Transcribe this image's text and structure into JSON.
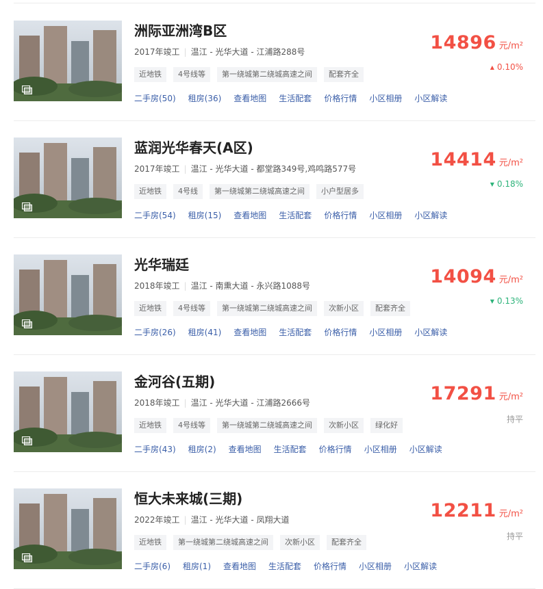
{
  "colors": {
    "price": "#f25044",
    "up": "#f25044",
    "down": "#2db37a",
    "link": "#3a5ea8"
  },
  "unit": "元/m²",
  "items": [
    {
      "name": "洲际亚洲湾B区",
      "year": "2017年竣工",
      "location": "温江 - 光华大道 - 江浦路288号",
      "tags": [
        "近地铁",
        "4号线等",
        "第一绕城第二绕城高速之间",
        "配套齐全"
      ],
      "links": [
        "二手房(50)",
        "租房(36)",
        "查看地图",
        "生活配套",
        "价格行情",
        "小区相册",
        "小区解读"
      ],
      "price": "14896",
      "change": "0.10%",
      "trend": "up",
      "trend_icon": "triangle-up-icon"
    },
    {
      "name": "蓝润光华春天(A区)",
      "year": "2017年竣工",
      "location": "温江 - 光华大道 - 都堂路349号,鸡鸣路577号",
      "tags": [
        "近地铁",
        "4号线",
        "第一绕城第二绕城高速之间",
        "小户型居多"
      ],
      "links": [
        "二手房(54)",
        "租房(15)",
        "查看地图",
        "生活配套",
        "价格行情",
        "小区相册",
        "小区解读"
      ],
      "price": "14414",
      "change": "0.18%",
      "trend": "down",
      "trend_icon": "triangle-down-icon"
    },
    {
      "name": "光华瑞廷",
      "year": "2018年竣工",
      "location": "温江 - 南熏大道 - 永兴路1088号",
      "tags": [
        "近地铁",
        "4号线等",
        "第一绕城第二绕城高速之间",
        "次新小区",
        "配套齐全"
      ],
      "links": [
        "二手房(26)",
        "租房(41)",
        "查看地图",
        "生活配套",
        "价格行情",
        "小区相册",
        "小区解读"
      ],
      "price": "14094",
      "change": "0.13%",
      "trend": "down",
      "trend_icon": "triangle-down-icon"
    },
    {
      "name": "金河谷(五期)",
      "year": "2018年竣工",
      "location": "温江 - 光华大道 - 江浦路2666号",
      "tags": [
        "近地铁",
        "4号线等",
        "第一绕城第二绕城高速之间",
        "次新小区",
        "绿化好"
      ],
      "links": [
        "二手房(43)",
        "租房(2)",
        "查看地图",
        "生活配套",
        "价格行情",
        "小区相册",
        "小区解读"
      ],
      "price": "17291",
      "change": "持平",
      "trend": "flat",
      "trend_icon": ""
    },
    {
      "name": "恒大未来城(三期)",
      "year": "2022年竣工",
      "location": "温江 - 光华大道 - 凤翔大道",
      "tags": [
        "近地铁",
        "第一绕城第二绕城高速之间",
        "次新小区",
        "配套齐全"
      ],
      "links": [
        "二手房(6)",
        "租房(1)",
        "查看地图",
        "生活配套",
        "价格行情",
        "小区相册",
        "小区解读"
      ],
      "price": "12211",
      "change": "持平",
      "trend": "flat",
      "trend_icon": ""
    }
  ]
}
